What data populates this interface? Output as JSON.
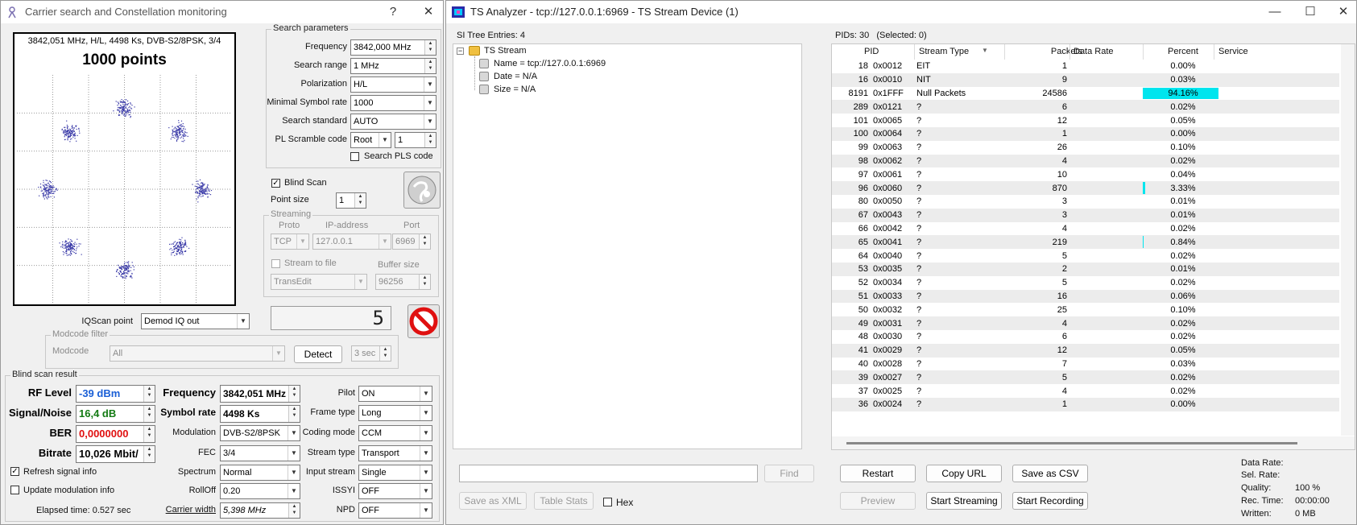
{
  "left_window": {
    "title": "Carrier search and Constellation monitoring",
    "help": "?",
    "close": "✕",
    "constellation": {
      "info": "3842,051 MHz, H/L, 4498 Ks, DVB-S2/8PSK, 3/4",
      "points": "1000 points"
    },
    "search": {
      "group": "Search parameters",
      "frequency_label": "Frequency",
      "frequency": "3842,000 MHz",
      "range_label": "Search range",
      "range": "1 MHz",
      "polarization_label": "Polarization",
      "polarization": "H/L",
      "min_sr_label": "Minimal Symbol rate",
      "min_sr": "1000",
      "standard_label": "Search standard",
      "standard": "AUTO",
      "pl_label": "PL Scramble code",
      "pl_mode": "Root",
      "pl_code": "1",
      "pls_label": "Search PLS code"
    },
    "blind_scan_label": "Blind Scan",
    "point_size_label": "Point size",
    "point_size": "1",
    "streaming": {
      "group": "Streaming",
      "proto_label": "Proto",
      "ip_label": "IP-address",
      "port_label": "Port",
      "proto": "TCP",
      "ip": "127.0.0.1",
      "port": "6969",
      "stf_label": "Stream to file",
      "buffer_label": "Buffer size",
      "file": "TransEdit",
      "buffer": "96256"
    },
    "counter": "5",
    "iqscan_label": "IQScan point",
    "iqscan": "Demod IQ out",
    "modcode": {
      "group": "Modcode filter",
      "label": "Modcode",
      "value": "All",
      "detect": "Detect",
      "interval": "3 sec"
    },
    "result": {
      "group": "Blind scan result",
      "rf_label": "RF Level",
      "rf": "-39 dBm",
      "sn_label": "Signal/Noise",
      "sn": "16,4 dB",
      "ber_label": "BER",
      "ber": "0,0000000",
      "bitrate_label": "Bitrate",
      "bitrate": "10,026 Mbit/",
      "freq_label": "Frequency",
      "freq": "3842,051 MHz",
      "sr_label": "Symbol rate",
      "sr": "4498 Ks",
      "mod_label": "Modulation",
      "mod": "DVB-S2/8PSK",
      "fec_label": "FEC",
      "fec": "3/4",
      "spectrum_label": "Spectrum",
      "spectrum": "Normal",
      "rolloff_label": "RollOff",
      "rolloff": "0.20",
      "cw_label": "Carrier width",
      "cw": "5,398 MHz",
      "pilot_label": "Pilot",
      "pilot": "ON",
      "frame_label": "Frame type",
      "frame": "Long",
      "coding_label": "Coding mode",
      "coding": "CCM",
      "stype_label": "Stream type",
      "stype": "Transport",
      "input_label": "Input stream",
      "input": "Single",
      "issyi_label": "ISSYI",
      "issyi": "OFF",
      "npd_label": "NPD",
      "npd": "OFF",
      "refresh_label": "Refresh signal info",
      "update_label": "Update modulation info",
      "elapsed": "Elapsed time: 0.527 sec"
    },
    "colors": {
      "rf": "#1a5fd6",
      "sn": "#137a13",
      "ber": "#e01010"
    }
  },
  "right_window": {
    "title": "TS Analyzer - tcp://127.0.0.1:6969 - TS Stream Device (1)",
    "minimize": "—",
    "maximize": "☐",
    "close": "✕",
    "si_header": "SI Tree Entries: 4",
    "tree": {
      "root": "TS Stream",
      "items": [
        "Name = tcp://127.0.0.1:6969",
        "Date = N/A",
        "Size = N/A"
      ]
    },
    "find": "Find",
    "save_xml": "Save as XML",
    "table_stats": "Table Stats",
    "hex": "Hex",
    "pids_header": "PIDs: 30   (Selected: 0)",
    "columns": {
      "pid": "PID",
      "type": "Stream Type",
      "packets": "Packets",
      "rate": "Data Rate",
      "percent": "Percent",
      "service": "Service"
    },
    "rows": [
      {
        "pid": "18",
        "hex": "0x0012",
        "type": "EIT",
        "packets": "1",
        "percent": "0.00%",
        "bar": 0
      },
      {
        "pid": "16",
        "hex": "0x0010",
        "type": "NIT",
        "packets": "9",
        "percent": "0.03%",
        "bar": 0
      },
      {
        "pid": "8191",
        "hex": "0x1FFF",
        "type": "Null Packets",
        "packets": "24586",
        "percent": "94.16%",
        "bar": 94.16
      },
      {
        "pid": "289",
        "hex": "0x0121",
        "type": "?",
        "packets": "6",
        "percent": "0.02%",
        "bar": 0
      },
      {
        "pid": "101",
        "hex": "0x0065",
        "type": "?",
        "packets": "12",
        "percent": "0.05%",
        "bar": 0
      },
      {
        "pid": "100",
        "hex": "0x0064",
        "type": "?",
        "packets": "1",
        "percent": "0.00%",
        "bar": 0
      },
      {
        "pid": "99",
        "hex": "0x0063",
        "type": "?",
        "packets": "26",
        "percent": "0.10%",
        "bar": 0
      },
      {
        "pid": "98",
        "hex": "0x0062",
        "type": "?",
        "packets": "4",
        "percent": "0.02%",
        "bar": 0
      },
      {
        "pid": "97",
        "hex": "0x0061",
        "type": "?",
        "packets": "10",
        "percent": "0.04%",
        "bar": 0
      },
      {
        "pid": "96",
        "hex": "0x0060",
        "type": "?",
        "packets": "870",
        "percent": "3.33%",
        "bar": 3.33
      },
      {
        "pid": "80",
        "hex": "0x0050",
        "type": "?",
        "packets": "3",
        "percent": "0.01%",
        "bar": 0
      },
      {
        "pid": "67",
        "hex": "0x0043",
        "type": "?",
        "packets": "3",
        "percent": "0.01%",
        "bar": 0
      },
      {
        "pid": "66",
        "hex": "0x0042",
        "type": "?",
        "packets": "4",
        "percent": "0.02%",
        "bar": 0
      },
      {
        "pid": "65",
        "hex": "0x0041",
        "type": "?",
        "packets": "219",
        "percent": "0.84%",
        "bar": 0.84
      },
      {
        "pid": "64",
        "hex": "0x0040",
        "type": "?",
        "packets": "5",
        "percent": "0.02%",
        "bar": 0
      },
      {
        "pid": "53",
        "hex": "0x0035",
        "type": "?",
        "packets": "2",
        "percent": "0.01%",
        "bar": 0
      },
      {
        "pid": "52",
        "hex": "0x0034",
        "type": "?",
        "packets": "5",
        "percent": "0.02%",
        "bar": 0
      },
      {
        "pid": "51",
        "hex": "0x0033",
        "type": "?",
        "packets": "16",
        "percent": "0.06%",
        "bar": 0
      },
      {
        "pid": "50",
        "hex": "0x0032",
        "type": "?",
        "packets": "25",
        "percent": "0.10%",
        "bar": 0
      },
      {
        "pid": "49",
        "hex": "0x0031",
        "type": "?",
        "packets": "4",
        "percent": "0.02%",
        "bar": 0
      },
      {
        "pid": "48",
        "hex": "0x0030",
        "type": "?",
        "packets": "6",
        "percent": "0.02%",
        "bar": 0
      },
      {
        "pid": "41",
        "hex": "0x0029",
        "type": "?",
        "packets": "12",
        "percent": "0.05%",
        "bar": 0
      },
      {
        "pid": "40",
        "hex": "0x0028",
        "type": "?",
        "packets": "7",
        "percent": "0.03%",
        "bar": 0
      },
      {
        "pid": "39",
        "hex": "0x0027",
        "type": "?",
        "packets": "5",
        "percent": "0.02%",
        "bar": 0
      },
      {
        "pid": "37",
        "hex": "0x0025",
        "type": "?",
        "packets": "4",
        "percent": "0.02%",
        "bar": 0
      },
      {
        "pid": "36",
        "hex": "0x0024",
        "type": "?",
        "packets": "1",
        "percent": "0.00%",
        "bar": 0
      }
    ],
    "buttons": {
      "restart": "Restart",
      "copy_url": "Copy URL",
      "save_csv": "Save as CSV",
      "preview": "Preview",
      "start_streaming": "Start Streaming",
      "start_recording": "Start Recording"
    },
    "stats": {
      "data_rate_label": "Data Rate:",
      "sel_rate_label": "Sel. Rate:",
      "quality_label": "Quality:",
      "quality": "100 %",
      "rec_time_label": "Rec. Time:",
      "rec_time": "00:00:00",
      "written_label": "Written:",
      "written": "0 MB"
    },
    "bar_color": "#00e5ee"
  }
}
